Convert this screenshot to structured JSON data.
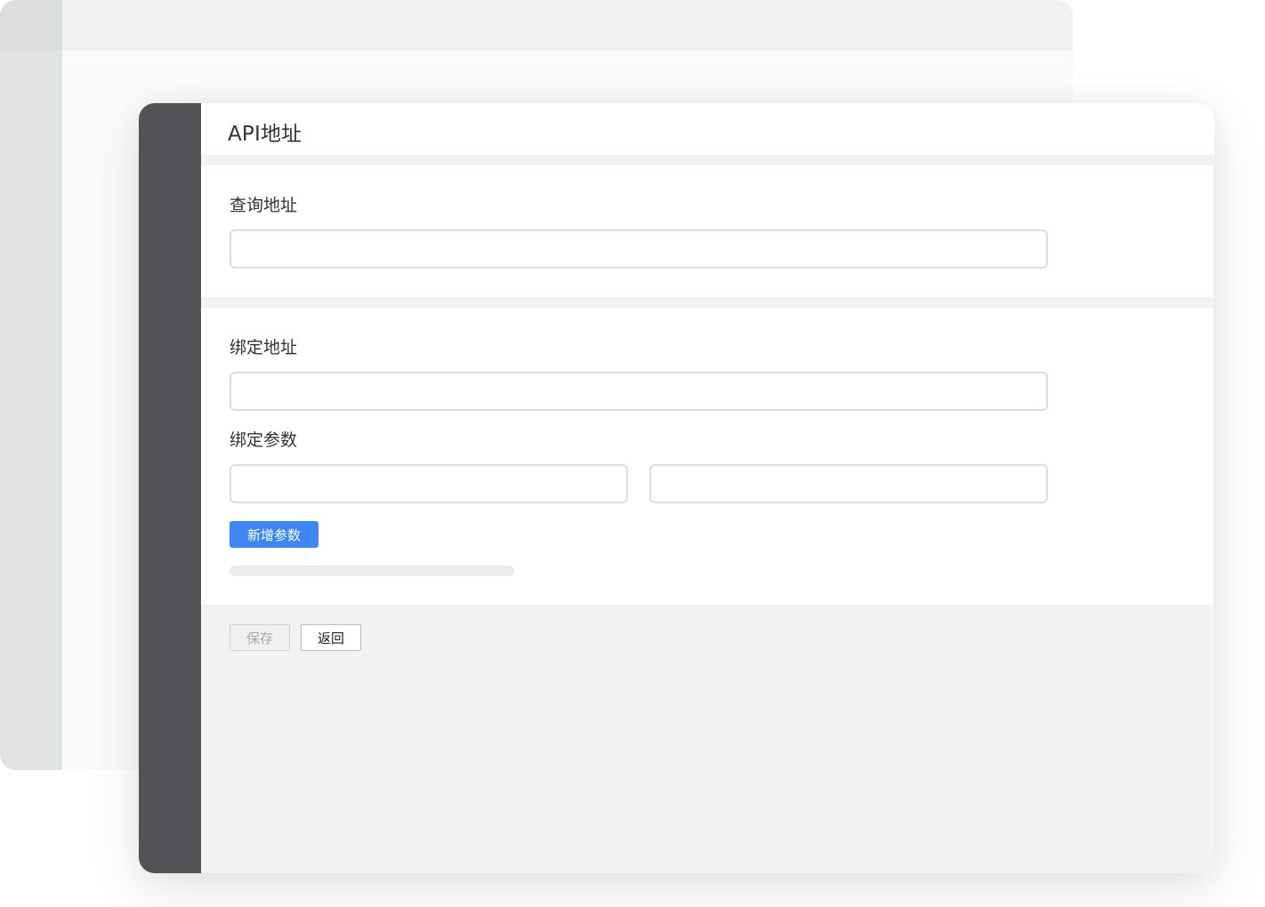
{
  "header": {
    "title": "API地址"
  },
  "query_section": {
    "label": "查询地址",
    "input_value": ""
  },
  "bind_section": {
    "address_label": "绑定地址",
    "address_value": "",
    "params_label": "绑定参数",
    "param_key_value": "",
    "param_value_value": "",
    "add_param_label": "新增参数"
  },
  "footer": {
    "save_label": "保存",
    "back_label": "返回"
  },
  "colors": {
    "sidebar": "#525357",
    "accent": "#3d86f4",
    "page_bg": "#f2f2f2"
  }
}
